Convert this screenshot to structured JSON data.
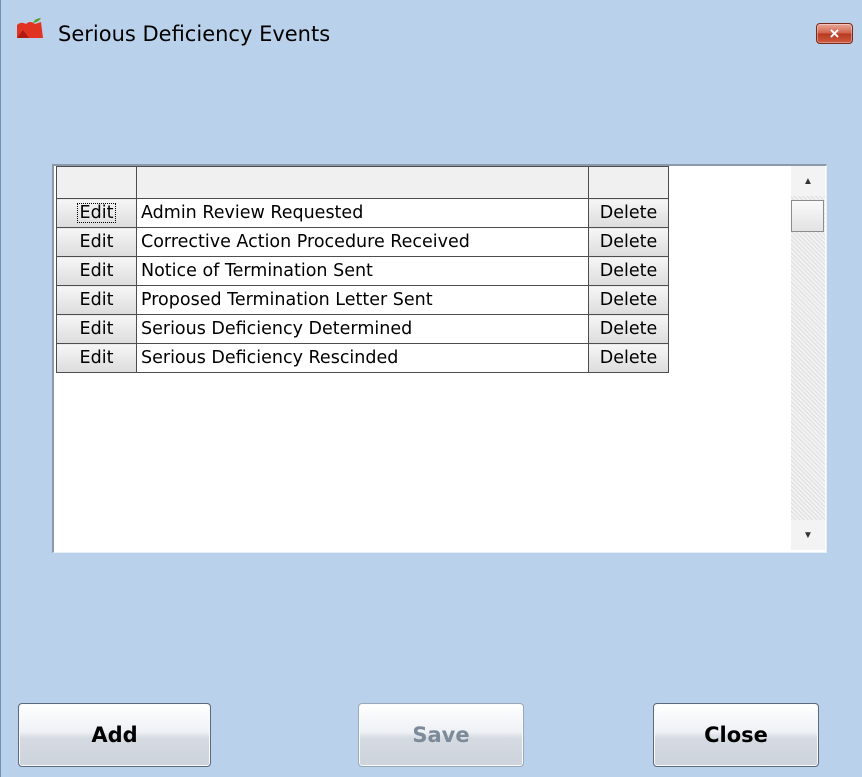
{
  "window": {
    "title": "Serious Deficiency Events",
    "close_label": "×"
  },
  "grid": {
    "header": [
      "",
      "",
      ""
    ],
    "rows": [
      {
        "edit": "Edit",
        "description": "Admin Review Requested",
        "delete": "Delete"
      },
      {
        "edit": "Edit",
        "description": "Corrective Action Procedure Received",
        "delete": "Delete"
      },
      {
        "edit": "Edit",
        "description": "Notice of Termination Sent",
        "delete": "Delete"
      },
      {
        "edit": "Edit",
        "description": "Proposed Termination Letter Sent",
        "delete": "Delete"
      },
      {
        "edit": "Edit",
        "description": "Serious Deficiency Determined",
        "delete": "Delete"
      },
      {
        "edit": "Edit",
        "description": "Serious Deficiency Rescinded",
        "delete": "Delete"
      }
    ]
  },
  "scrollbar": {
    "up_icon": "▲",
    "down_icon": "▼"
  },
  "buttons": {
    "add": "Add",
    "save": "Save",
    "close": "Close"
  },
  "colors": {
    "background": "#b9d1ea",
    "close_button": "#c8503a",
    "disabled_text": "#7c8a99"
  }
}
